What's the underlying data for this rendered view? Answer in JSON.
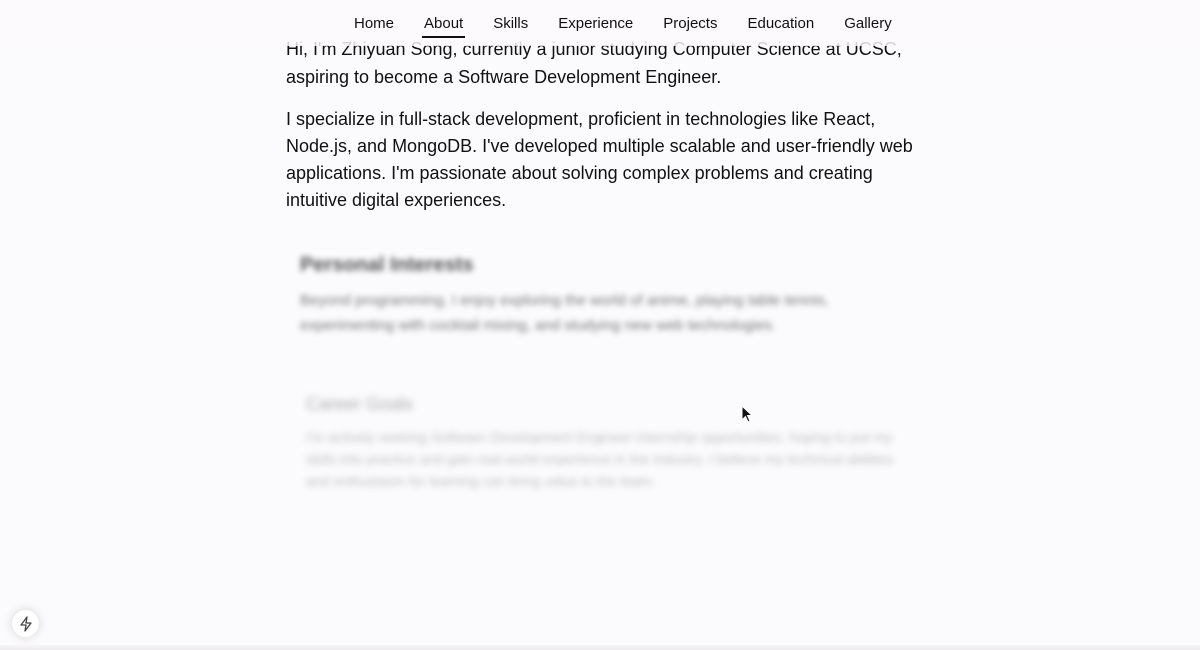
{
  "nav": {
    "items": [
      "Home",
      "About",
      "Skills",
      "Experience",
      "Projects",
      "Education",
      "Gallery"
    ],
    "active": "About"
  },
  "intro": {
    "paragraph1": "Hi, I'm Zhiyuan Song, currently a junior studying Computer Science at UCSC, aspiring to become a Software Development Engineer.",
    "paragraph2": "I specialize in full-stack development, proficient in technologies like React, Node.js, and MongoDB. I've developed multiple scalable and user-friendly web applications. I'm passionate about solving complex problems and creating intuitive digital experiences."
  },
  "personal_interests": {
    "title": "Personal Interests",
    "text": "Beyond programming, I enjoy exploring the world of anime, playing table tennis, experimenting with cocktail mixing, and studying new web technologies."
  },
  "career_goals": {
    "title": "Career Goals",
    "text": "I'm actively seeking Software Development Engineer internship opportunities, hoping to put my skills into practice and gain real-world experience in the industry. I believe my technical abilities and enthusiasm for learning can bring value to the team."
  },
  "badge": {
    "icon": "lightning-icon"
  },
  "colors": {
    "background": "#fbfafc",
    "text": "#111111",
    "active_underline": "#111111"
  }
}
